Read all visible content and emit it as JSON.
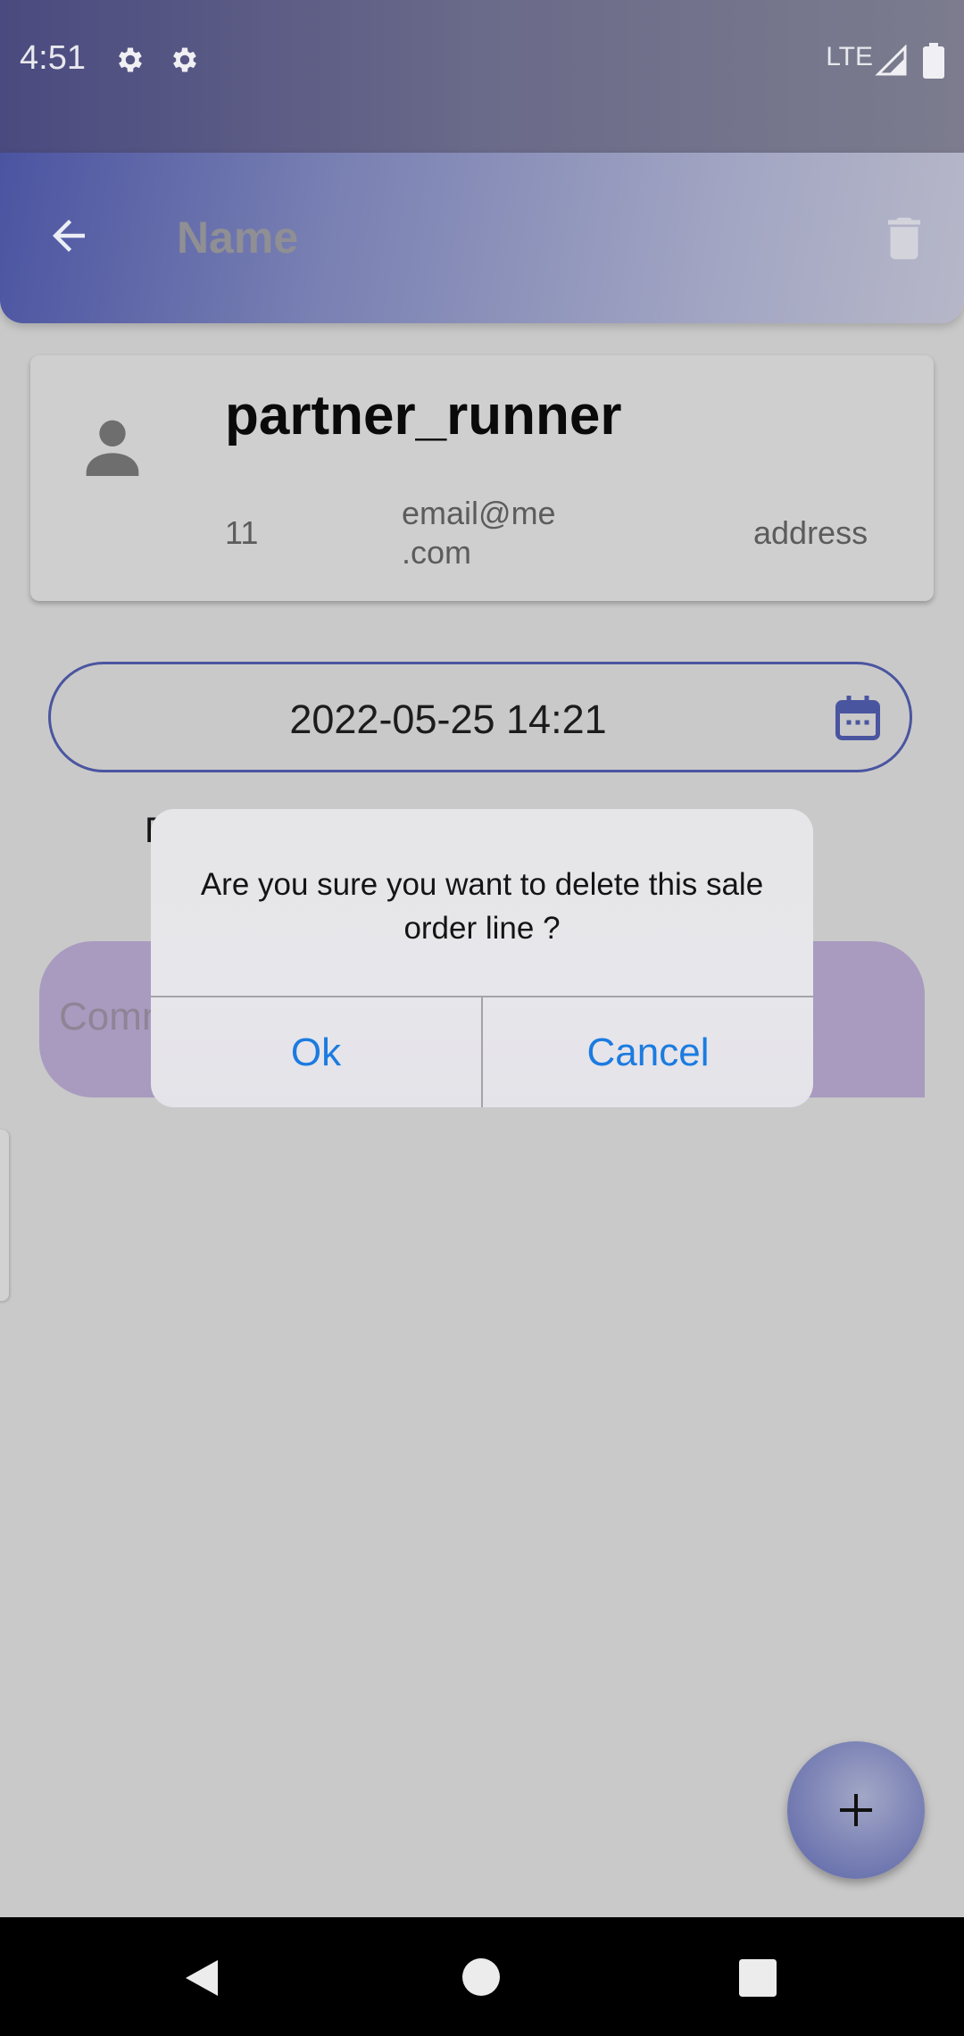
{
  "status_bar": {
    "time": "4:51",
    "icons": [
      "gear-icon",
      "gear-icon"
    ],
    "network": "LTE",
    "signal_icon": "signal-icon",
    "battery_icon": "battery-icon"
  },
  "app_bar": {
    "back_icon": "arrow-back-icon",
    "title": "Name",
    "delete_icon": "trash-icon"
  },
  "partner_card": {
    "avatar_icon": "person-icon",
    "name": "partner_runner",
    "number": "11",
    "email_line1": "email@me",
    "email_line2": ".com",
    "address": "address"
  },
  "date_field": {
    "value": "2022-05-25  14:21",
    "calendar_icon": "calendar-icon"
  },
  "partially_hidden_label": "D",
  "comment_field": {
    "placeholder": "Comm"
  },
  "dialog": {
    "message": "Are you sure you want to delete this sale order line ?",
    "ok_label": "Ok",
    "cancel_label": "Cancel"
  },
  "fab": {
    "icon": "plus-icon"
  },
  "nav_bar": {
    "back_icon": "nav-back-icon",
    "home_icon": "nav-home-icon",
    "recents_icon": "nav-recents-icon"
  },
  "colors": {
    "accent": "#4a55a0",
    "dialog_button": "#1b7be0",
    "scrim_background": "#c9c9c9"
  }
}
